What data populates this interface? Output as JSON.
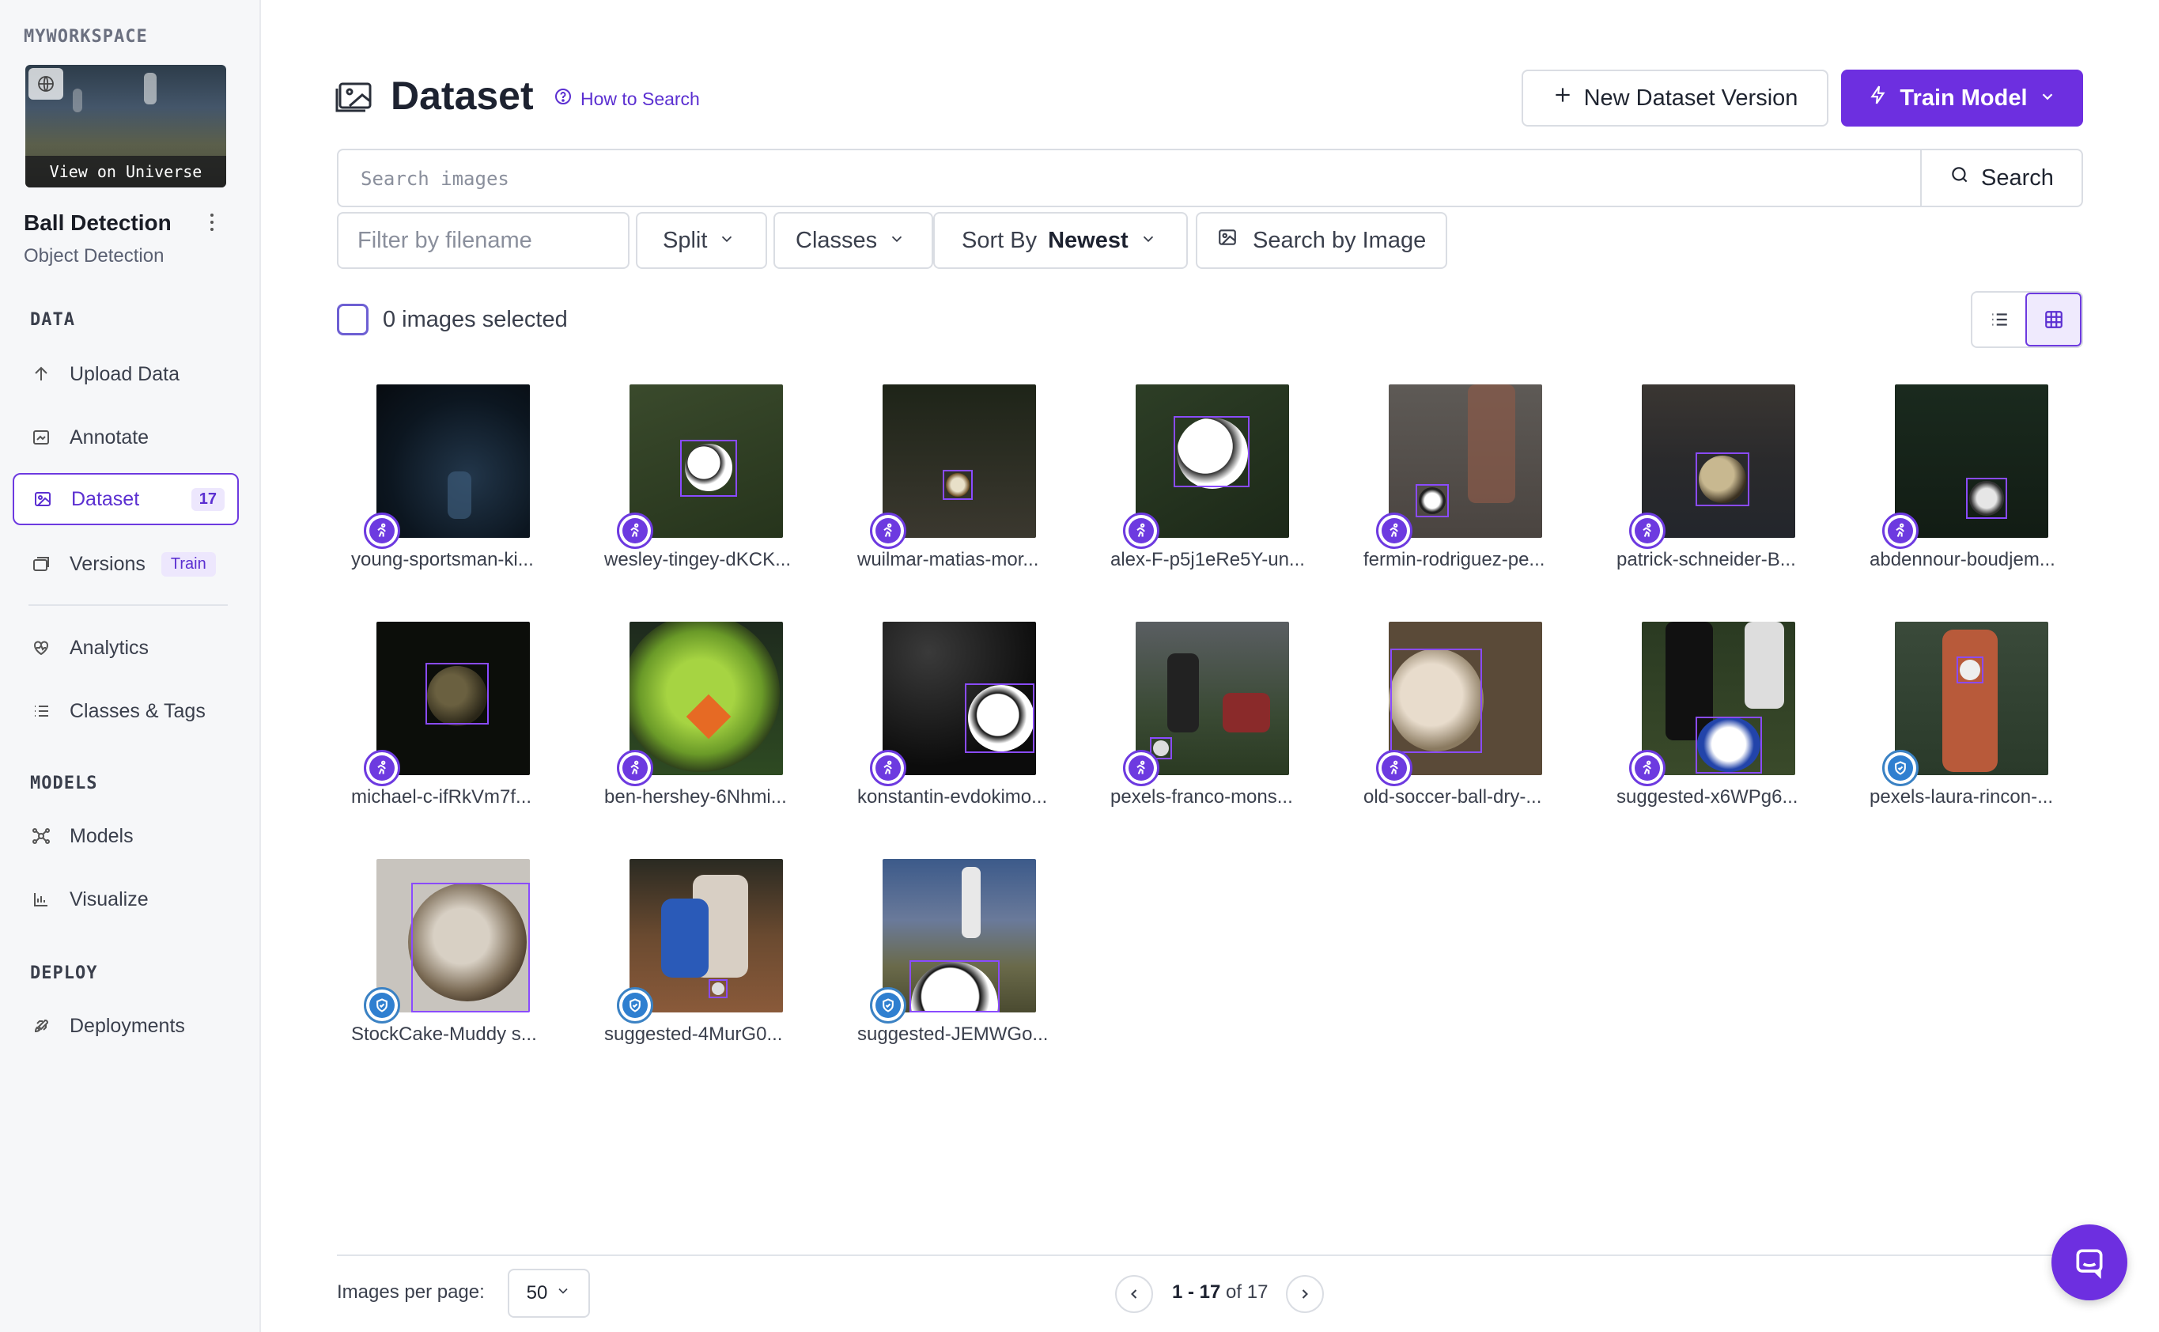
{
  "sidebar": {
    "workspace_label": "MYWORKSPACE",
    "thumb_view_label": "View on Universe",
    "project_name": "Ball Detection",
    "project_type": "Object Detection",
    "sections": {
      "data": "DATA",
      "models": "MODELS",
      "deploy": "DEPLOY"
    },
    "items": {
      "upload": "Upload Data",
      "annotate": "Annotate",
      "dataset": "Dataset",
      "dataset_count": "17",
      "versions": "Versions",
      "versions_badge": "Train",
      "analytics": "Analytics",
      "classes": "Classes & Tags",
      "models": "Models",
      "visualize": "Visualize",
      "deployments": "Deployments"
    }
  },
  "header": {
    "title": "Dataset",
    "how_to_search": "How to Search",
    "new_version_label": "New Dataset Version",
    "train_label": "Train Model"
  },
  "search": {
    "placeholder": "Search images",
    "button_label": "Search"
  },
  "filters": {
    "filename_placeholder": "Filter by filename",
    "split_label": "Split",
    "classes_label": "Classes",
    "sort_label": "Sort By",
    "sort_value": "Newest",
    "search_by_image_label": "Search by Image"
  },
  "selection": {
    "label": "0 images selected"
  },
  "images": [
    {
      "name": "young-sportsman-ki...",
      "status": "annotating"
    },
    {
      "name": "wesley-tingey-dKCK...",
      "status": "annotating"
    },
    {
      "name": "wuilmar-matias-mor...",
      "status": "annotating"
    },
    {
      "name": "alex-F-p5j1eRe5Y-un...",
      "status": "annotating"
    },
    {
      "name": "fermin-rodriguez-pe...",
      "status": "annotating"
    },
    {
      "name": "patrick-schneider-B...",
      "status": "annotating"
    },
    {
      "name": "abdennour-boudjem...",
      "status": "annotating"
    },
    {
      "name": "michael-c-ifRkVm7f...",
      "status": "annotating"
    },
    {
      "name": "ben-hershey-6Nhmi...",
      "status": "annotating"
    },
    {
      "name": "konstantin-evdokimo...",
      "status": "annotating"
    },
    {
      "name": "pexels-franco-mons...",
      "status": "annotating"
    },
    {
      "name": "old-soccer-ball-dry-...",
      "status": "annotating"
    },
    {
      "name": "suggested-x6WPg6...",
      "status": "annotating"
    },
    {
      "name": "pexels-laura-rincon-...",
      "status": "approved"
    },
    {
      "name": "StockCake-Muddy s...",
      "status": "approved"
    },
    {
      "name": "suggested-4MurG0...",
      "status": "approved"
    },
    {
      "name": "suggested-JEMWGo...",
      "status": "approved"
    }
  ],
  "footer": {
    "per_page_label": "Images per page:",
    "per_page_value": "50",
    "range": "1 - 17",
    "of_total": "of 17"
  },
  "colors": {
    "accent": "#6d2fe0",
    "approved": "#2f7fd0"
  }
}
